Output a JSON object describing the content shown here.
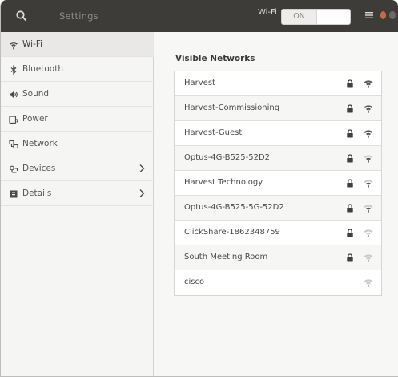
{
  "header": {
    "title": "Settings",
    "wifi_label": "Wi-Fi",
    "switch_state": "ON",
    "search_icon": "search-icon",
    "menu_icon": "hamburger-menu-icon"
  },
  "sidebar": {
    "items": [
      {
        "label": "Wi-Fi",
        "icon": "wifi-icon",
        "selected": true,
        "chevron": false
      },
      {
        "label": "Bluetooth",
        "icon": "bluetooth-icon",
        "selected": false,
        "chevron": false
      },
      {
        "label": "Sound",
        "icon": "speaker-icon",
        "selected": false,
        "chevron": false
      },
      {
        "label": "Power",
        "icon": "battery-icon",
        "selected": false,
        "chevron": false
      },
      {
        "label": "Network",
        "icon": "network-icon",
        "selected": false,
        "chevron": false
      },
      {
        "label": "Devices",
        "icon": "devices-icon",
        "selected": false,
        "chevron": true
      },
      {
        "label": "Details",
        "icon": "info-icon",
        "selected": false,
        "chevron": true
      }
    ]
  },
  "main": {
    "section_title": "Visible Networks",
    "networks": [
      {
        "name": "Harvest",
        "locked": true,
        "signal": "strong"
      },
      {
        "name": "Harvest-Commissioning",
        "locked": true,
        "signal": "strong"
      },
      {
        "name": "Harvest-Guest",
        "locked": true,
        "signal": "strong"
      },
      {
        "name": "Optus-4G-B525-52D2",
        "locked": true,
        "signal": "medium"
      },
      {
        "name": "Harvest Technology",
        "locked": true,
        "signal": "medium"
      },
      {
        "name": "Optus-4G-B525-5G-52D2",
        "locked": true,
        "signal": "medium"
      },
      {
        "name": "ClickShare-1862348759",
        "locked": true,
        "signal": "weak"
      },
      {
        "name": "South Meeting Room",
        "locked": true,
        "signal": "weak"
      },
      {
        "name": "cisco",
        "locked": false,
        "signal": "weak"
      }
    ]
  },
  "colors": {
    "headerbar": "#3d3c39",
    "window_control_accent": "#c66b3d",
    "sidebar_selected": "#e9e8e6",
    "text": "#4b4b48"
  }
}
